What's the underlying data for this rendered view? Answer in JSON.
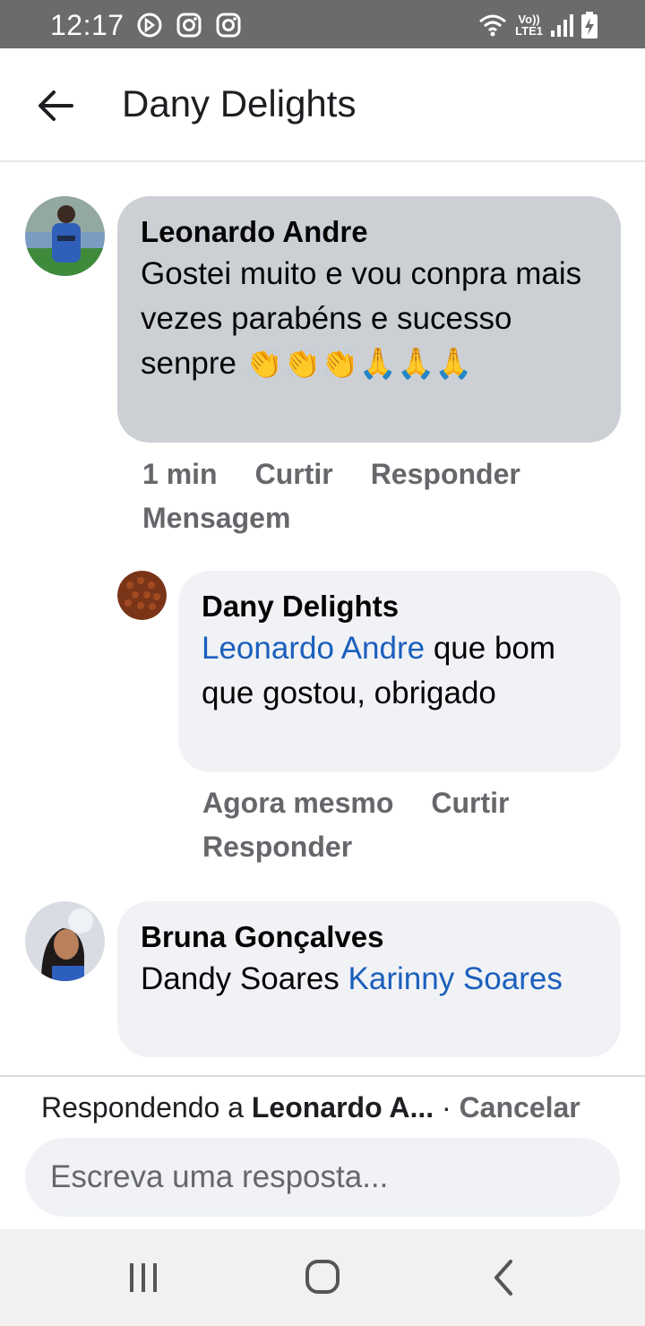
{
  "status_bar": {
    "time": "12:17",
    "network_top": "Vo))",
    "network_bottom": "LTE1"
  },
  "header": {
    "title": "Dany Delights"
  },
  "comments": [
    {
      "author": "Leonardo Andre",
      "text": "Gostei muito e vou conpra mais vezes parabéns e sucesso senpre",
      "emojis": "👏👏👏🙏🙏🙏",
      "actions": [
        "1 min",
        "Curtir",
        "Responder",
        "Mensagem"
      ]
    },
    {
      "author": "Dany Delights",
      "mention": "Leonardo Andre",
      "text": " que bom que gostou, obrigado",
      "actions": [
        "Agora mesmo",
        "Curtir",
        "Responder"
      ]
    },
    {
      "author": "Bruna Gonçalves",
      "text_plain": "Dandy Soares ",
      "mention": "Karinny Soares"
    }
  ],
  "reply_bar": {
    "prefix": "Respondendo a ",
    "target": "Leonardo A...",
    "separator": " · ",
    "cancel": "Cancelar",
    "placeholder": "Escreva uma resposta..."
  },
  "colors": {
    "status_bar": "#6b6b6b",
    "highlight_bubble": "#ccd0d5",
    "bubble": "#f0f2f5",
    "mention": "#1b5fbd",
    "secondary_text": "#65676b"
  },
  "icons": {
    "back": "arrow-left-icon",
    "nav_recent": "recent-apps-icon",
    "nav_home": "home-icon",
    "nav_back": "back-icon"
  }
}
